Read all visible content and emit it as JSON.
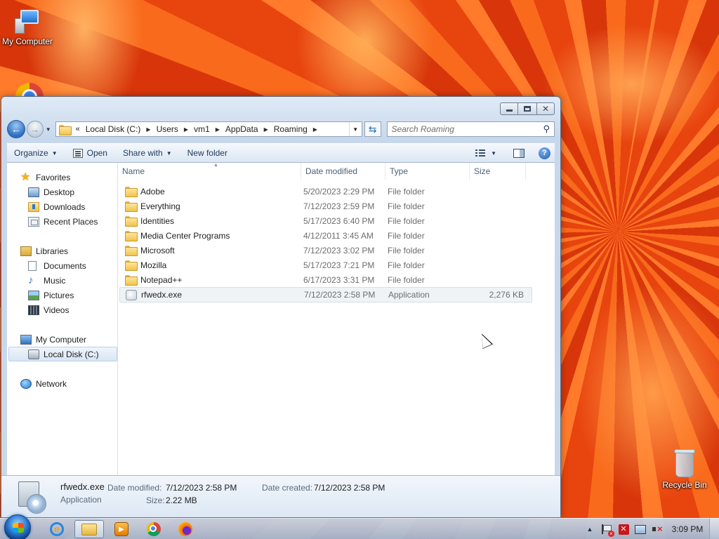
{
  "desktop": {
    "icons": [
      {
        "label": "My Computer"
      },
      {
        "label": "Recycle Bin"
      }
    ]
  },
  "window": {
    "address": {
      "overflow": "«",
      "crumbs": [
        "Local Disk (C:)",
        "Users",
        "vm1",
        "AppData",
        "Roaming"
      ]
    },
    "search": {
      "placeholder": "Search Roaming"
    },
    "toolbar": {
      "organize": "Organize",
      "open": "Open",
      "share_with": "Share with",
      "new_folder": "New folder"
    },
    "nav": {
      "favorites": "Favorites",
      "desktop": "Desktop",
      "downloads": "Downloads",
      "recent_places": "Recent Places",
      "libraries": "Libraries",
      "documents": "Documents",
      "music": "Music",
      "pictures": "Pictures",
      "videos": "Videos",
      "my_computer": "My Computer",
      "local_disk": "Local Disk (C:)",
      "network": "Network"
    },
    "columns": {
      "name": "Name",
      "date_modified": "Date modified",
      "type": "Type",
      "size": "Size"
    },
    "files": [
      {
        "name": "Adobe",
        "date": "5/20/2023 2:29 PM",
        "type": "File folder",
        "size": ""
      },
      {
        "name": "Everything",
        "date": "7/12/2023 2:59 PM",
        "type": "File folder",
        "size": ""
      },
      {
        "name": "Identities",
        "date": "5/17/2023 6:40 PM",
        "type": "File folder",
        "size": ""
      },
      {
        "name": "Media Center Programs",
        "date": "4/12/2011 3:45 AM",
        "type": "File folder",
        "size": ""
      },
      {
        "name": "Microsoft",
        "date": "7/12/2023 3:02 PM",
        "type": "File folder",
        "size": ""
      },
      {
        "name": "Mozilla",
        "date": "5/17/2023 7:21 PM",
        "type": "File folder",
        "size": ""
      },
      {
        "name": "Notepad++",
        "date": "6/17/2023 3:31 PM",
        "type": "File folder",
        "size": ""
      },
      {
        "name": "rfwedx.exe",
        "date": "7/12/2023 2:58 PM",
        "type": "Application",
        "size": "2,276 KB"
      }
    ],
    "details": {
      "name": "rfwedx.exe",
      "type": "Application",
      "date_modified_label": "Date modified:",
      "date_modified": "7/12/2023 2:58 PM",
      "date_created_label": "Date created:",
      "date_created": "7/12/2023 2:58 PM",
      "size_label": "Size:",
      "size": "2.22 MB"
    }
  },
  "taskbar": {
    "clock": "3:09 PM"
  }
}
